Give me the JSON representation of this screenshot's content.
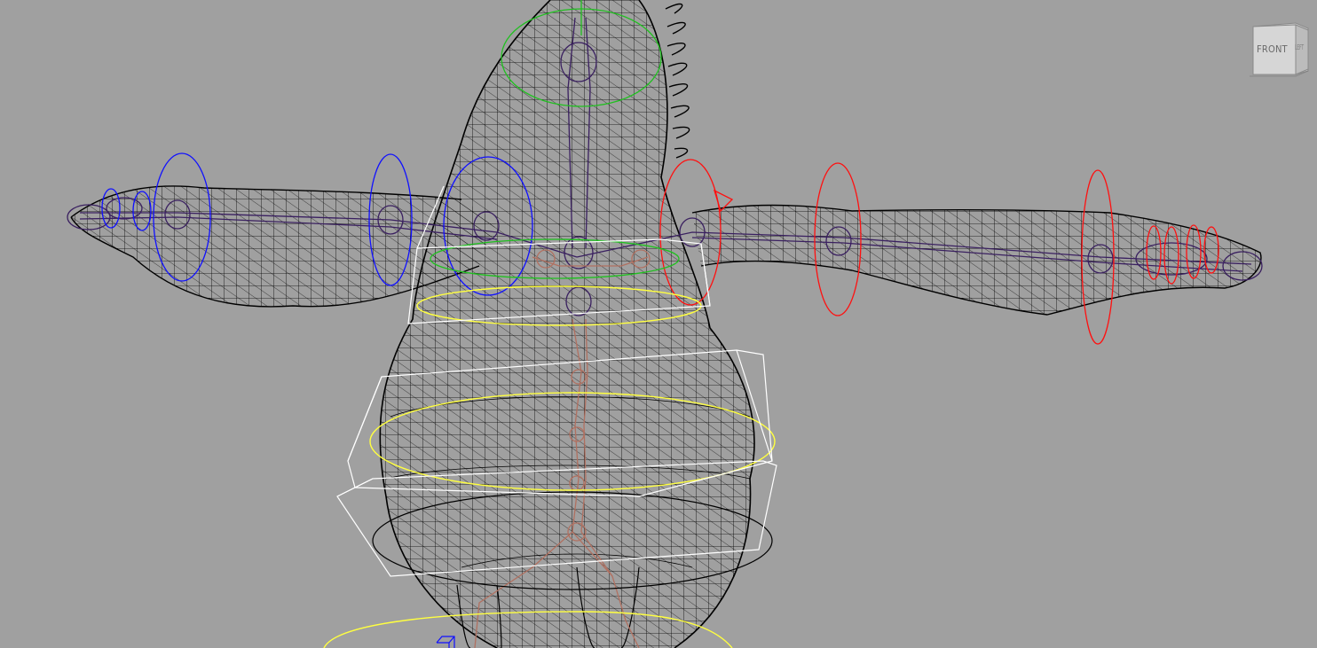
{
  "viewport": {
    "background": "#a0a0a0"
  },
  "viewcube": {
    "front_label": "FRONT",
    "side_label": "LEFT"
  },
  "colors": {
    "mesh": "#000000",
    "bones": "#3a2060",
    "spine_bones": "#b07060",
    "left_arm_ctrl": "#1010ff",
    "right_arm_ctrl": "#ff1010",
    "torso_ctrl": "#ffff40",
    "neck_ctrl": "#20c020",
    "box_ctrl": "#ffffff"
  }
}
